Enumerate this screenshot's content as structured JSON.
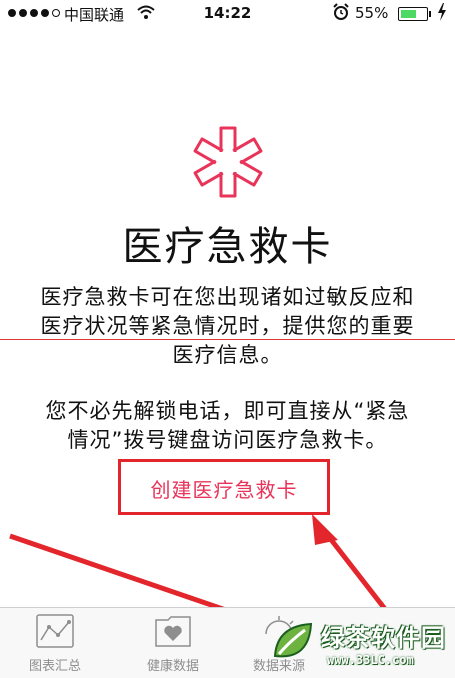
{
  "status_bar": {
    "carrier": "中国联通",
    "wifi_icon": "wifi-icon",
    "time": "14:22",
    "alarm_icon": "alarm-icon",
    "battery_percent": "55%",
    "battery_level": 0.55,
    "charging_icon": "bolt-icon"
  },
  "main": {
    "icon": "medical-asterisk-icon",
    "accent_color": "#e9345a",
    "title": "医疗急救卡",
    "description": "医疗急救卡可在您出现诸如过敏反应和医疗状况等紧急情况时，提供您的重要医疗信息。",
    "lock_note": "您不必先解锁电话，即可直接从“紧急情况”拨号键盘访问医疗急救卡。",
    "create_button": "创建医疗急救卡"
  },
  "tab_bar": {
    "tabs": [
      {
        "label": "图表汇总",
        "icon": "chart-icon"
      },
      {
        "label": "健康数据",
        "icon": "health-folder-icon"
      },
      {
        "label": "数据来源",
        "icon": "data-source-icon"
      }
    ]
  },
  "watermark": {
    "title": "绿茶软件园",
    "url": "www.33LC.com"
  },
  "annotation_color": "#e3262c"
}
